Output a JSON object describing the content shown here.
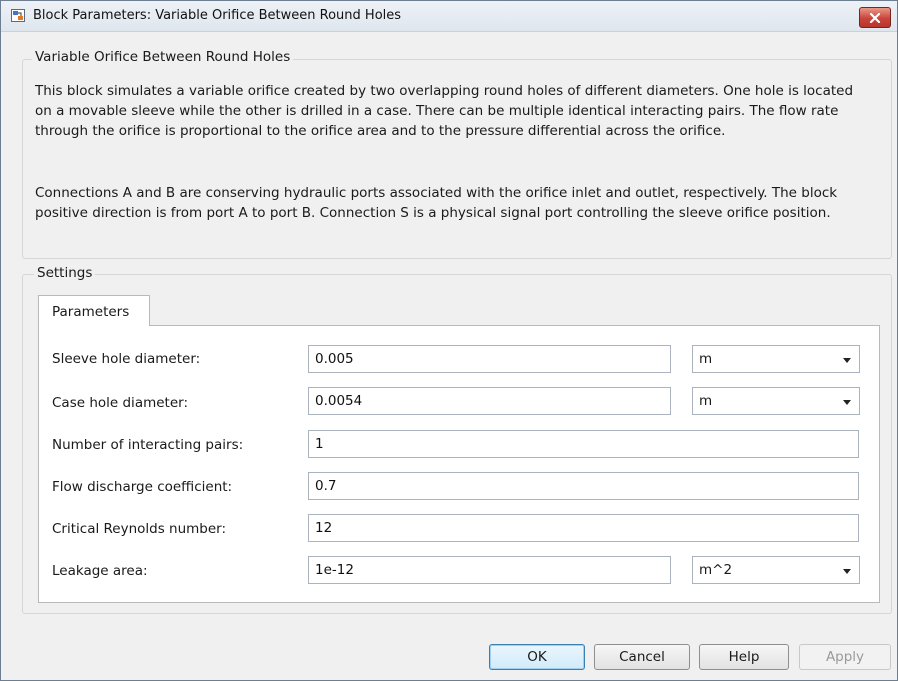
{
  "window": {
    "title": "Block Parameters: Variable Orifice Between Round Holes"
  },
  "block": {
    "name": "Variable Orifice Between Round Holes",
    "description_1": "This block simulates a variable orifice created by two overlapping round holes of different diameters. One hole is located on a movable sleeve while the other is drilled in a case. There can be multiple identical interacting pairs. The flow rate through the orifice is proportional to the orifice area and to the pressure differential across the orifice.",
    "description_2": "Connections A and B are conserving hydraulic ports associated with the orifice inlet and outlet, respectively. The block positive direction is from port A to port B. Connection S is a physical signal port controlling the sleeve orifice position."
  },
  "settings": {
    "legend": "Settings",
    "tab_label": "Parameters",
    "params": [
      {
        "label": "Sleeve hole diameter:",
        "value": "0.005",
        "unit": "m"
      },
      {
        "label": "Case hole diameter:",
        "value": "0.0054",
        "unit": "m"
      },
      {
        "label": "Number of interacting pairs:",
        "value": "1"
      },
      {
        "label": "Flow discharge coefficient:",
        "value": "0.7"
      },
      {
        "label": "Critical Reynolds number:",
        "value": "12"
      },
      {
        "label": "Leakage area:",
        "value": "1e-12",
        "unit": "m^2"
      }
    ]
  },
  "buttons": {
    "ok": "OK",
    "cancel": "Cancel",
    "help": "Help",
    "apply": "Apply"
  },
  "colors": {
    "window_bg": "#f0f0f0",
    "close_button": "#c9443a",
    "default_button_border": "#3c7fb1"
  },
  "icons": {
    "title": "simulink-block-icon",
    "close": "close-icon",
    "dropdown": "chevron-down-icon"
  }
}
